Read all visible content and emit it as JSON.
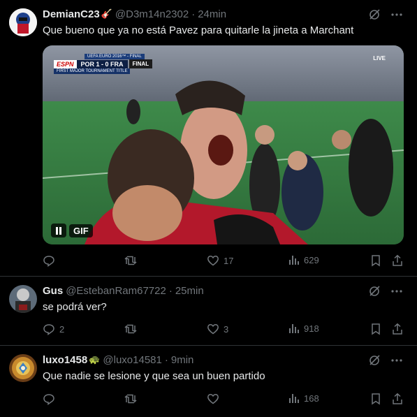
{
  "tweets": [
    {
      "name": "DemianC23",
      "name_emoji": "🎸",
      "handle": "@D3m14n2302",
      "separator": "·",
      "time": "24min",
      "text": "Que bueno que ya no está Pavez para quitarle la jineta a Marchant",
      "media": {
        "gif_label": "GIF",
        "scoreboard_title": "UEFA EURO 2016™ - FINAL",
        "scoreboard_score": "POR 1 - 0 FRA",
        "scoreboard_status": "FINAL",
        "scoreboard_sub": "FIRST MAJOR TOURNAMENT TITLE",
        "broadcaster": "ESPN",
        "live_tag": "LIVE"
      },
      "replies": "",
      "retweets": "",
      "likes": "17",
      "views": "629"
    },
    {
      "name": "Gus",
      "name_emoji": "",
      "handle": "@EstebanRam67722",
      "separator": "·",
      "time": "25min",
      "text": "se podrá ver?",
      "replies": "2",
      "retweets": "",
      "likes": "3",
      "views": "918"
    },
    {
      "name": "luxo1458",
      "name_emoji": "🐢",
      "handle": "@luxo14581",
      "separator": "·",
      "time": "9min",
      "text": "Que nadie se lesione y que sea un buen partido",
      "replies": "",
      "retweets": "",
      "likes": "",
      "views": "168"
    }
  ],
  "colors": {
    "background": "#000000",
    "text": "#e7e9ea",
    "muted": "#71767b",
    "divider": "#2f3336"
  }
}
